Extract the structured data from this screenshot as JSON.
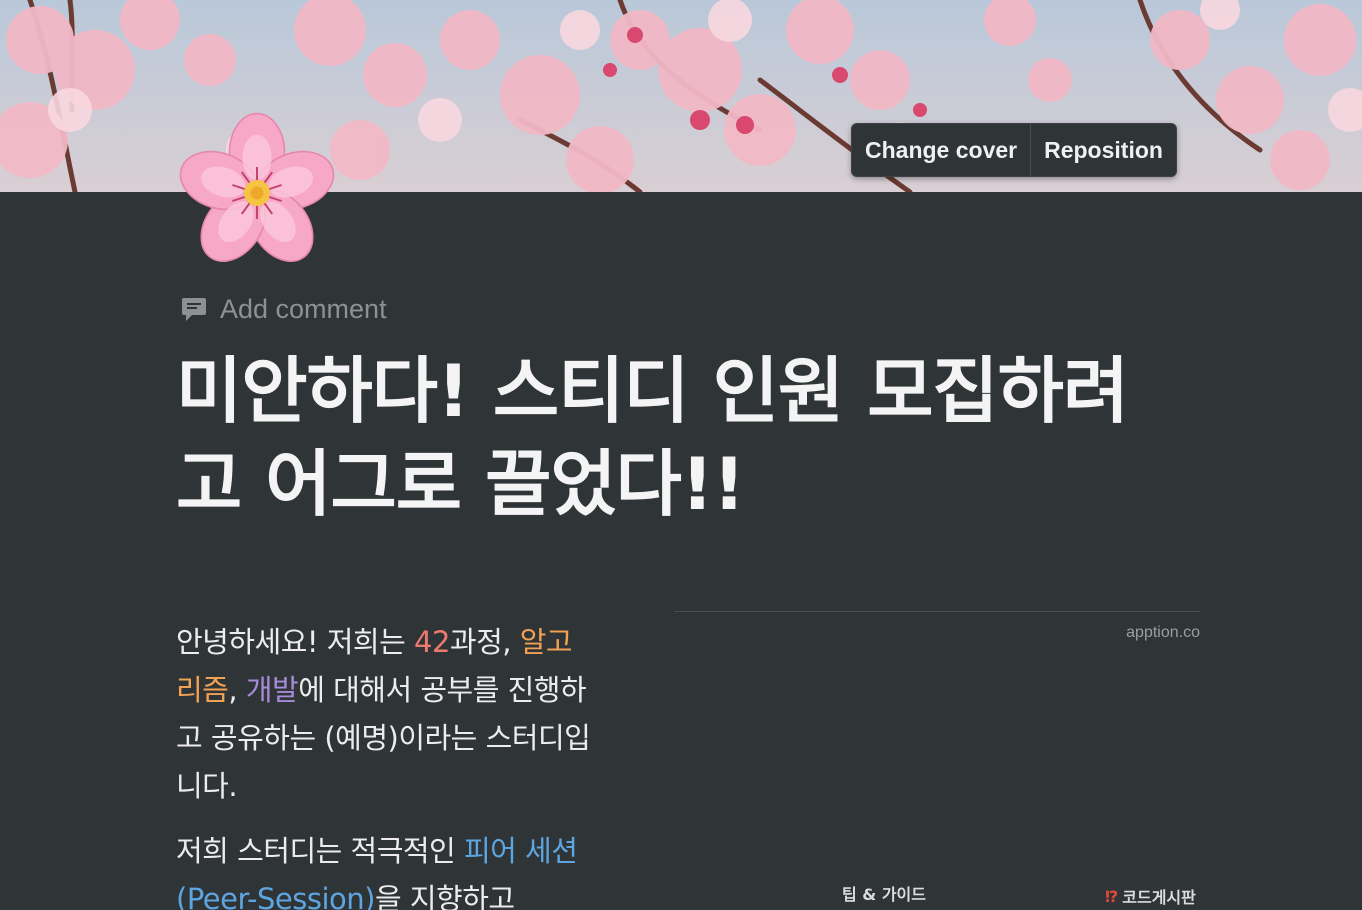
{
  "cover": {
    "change_cover_label": "Change cover",
    "reposition_label": "Reposition"
  },
  "page": {
    "icon": "cherry-blossom-icon",
    "add_comment_label": "Add comment",
    "title": "미안하다! 스티디 인원 모집하려고 어그로 끌었다!!"
  },
  "content": {
    "p1": {
      "t1": "안녕하세요! 저희는 ",
      "h1": "42",
      "t2": "과정, ",
      "h2": "알고리즘",
      "t3": ", ",
      "h3": "개발",
      "t4": "에 대해서 공부를 진행하고 공유하는 (예명)이라는 스터디입니다."
    },
    "p2": {
      "t1": "저희 스터디는 적극적인 ",
      "h1": "피어 세션 (Peer-Session)",
      "t2": "을 지향하고"
    }
  },
  "embed": {
    "domain": "apption.co",
    "tab_left": "팁 & 가이드",
    "tab_right_mark": "⁉",
    "tab_right": "코드게시판"
  },
  "colors": {
    "background": "#2f3437",
    "red": "#ec7a6e",
    "orange": "#f0a153",
    "purple": "#a78bd8",
    "blue": "#5ea5e0"
  }
}
